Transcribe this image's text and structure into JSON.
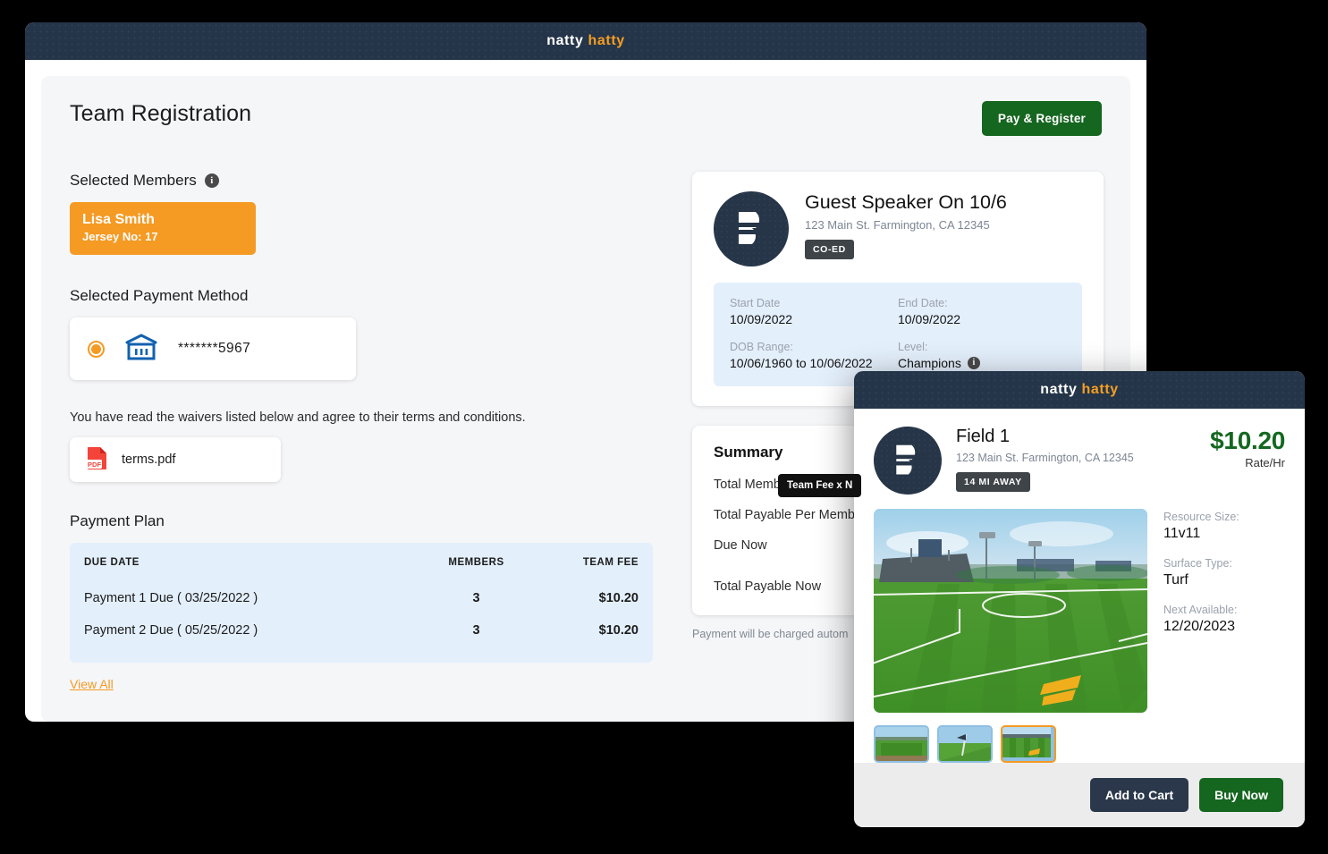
{
  "brand": {
    "word1": "natty",
    "word2": "hatty"
  },
  "main": {
    "page_title": "Team Registration",
    "pay_register_label": "Pay & Register",
    "selected_members_label": "Selected Members",
    "members": [
      {
        "name": "Lisa Smith",
        "jersey": "Jersey No: 17"
      }
    ],
    "payment_method_label": "Selected Payment Method",
    "payment_method": {
      "account": "*******5967",
      "icon": "bank-icon",
      "selected": true
    },
    "waiver_text": "You have read the waivers listed below and agree to their terms and conditions.",
    "waiver_file": {
      "name": "terms.pdf",
      "icon": "pdf-icon"
    },
    "payment_plan_title": "Payment Plan",
    "plan_columns": [
      "DUE DATE",
      "MEMBERS",
      "TEAM FEE"
    ],
    "plan_rows": [
      {
        "due": "Payment 1 Due ( 03/25/2022 )",
        "members": "3",
        "fee": "$10.20"
      },
      {
        "due": "Payment 2 Due ( 05/25/2022 )",
        "members": "3",
        "fee": "$10.20"
      }
    ],
    "view_all_label": "View All"
  },
  "event": {
    "title": "Guest Speaker On 10/6",
    "address": "123 Main St. Farmington, CA 12345",
    "tag": "CO-ED",
    "start_date_label": "Start Date",
    "start_date": "10/09/2022",
    "end_date_label": "End Date:",
    "end_date": "10/09/2022",
    "dob_label": "DOB Range:",
    "dob_range": "10/06/1960 to 10/06/2022",
    "level_label": "Level:",
    "level": "Champions"
  },
  "summary": {
    "title": "Summary",
    "rows": [
      "Total Members Selected",
      "Total Payable Per Member",
      "Due Now",
      "Total Payable Now"
    ],
    "tooltip": "Team Fee x N",
    "footnote": "Payment will be charged autom"
  },
  "field": {
    "title": "Field 1",
    "address": "123 Main St. Farmington, CA 12345",
    "distance_tag": "14 MI AWAY",
    "price": "$10.20",
    "rate_label": "Rate/Hr",
    "resource_size_label": "Resource Size:",
    "resource_size": "11v11",
    "surface_label": "Surface Type:",
    "surface": "Turf",
    "next_available_label": "Next Available:",
    "next_available": "12/20/2023",
    "add_to_cart_label": "Add to Cart",
    "buy_now_label": "Buy Now",
    "thumbnails": [
      {
        "name": "field-aerial",
        "selected": false
      },
      {
        "name": "field-corner-flag",
        "selected": false
      },
      {
        "name": "field-stadium",
        "selected": true
      }
    ]
  },
  "colors": {
    "header_navy": "#253549",
    "brand_orange": "#f59a23",
    "green": "#15661f",
    "info_blue": "#e3effb",
    "dark_button": "#2b384b"
  }
}
